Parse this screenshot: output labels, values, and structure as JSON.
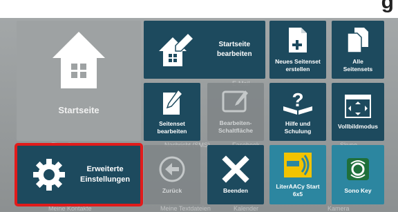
{
  "header": {
    "partial_title": "g"
  },
  "background_labels": {
    "settings": "Einstellungen",
    "message_sms": "Nachricht (SMS)",
    "facebook": "Facebook",
    "skype": "Skype",
    "my_contacts": "Meine Kontakte",
    "my_text_files": "Meine Textdateien",
    "calendar": "Kalender",
    "camera": "Kamera",
    "email": "E-Mail"
  },
  "tiles": {
    "home": {
      "label": "Startseite"
    },
    "start_edit": {
      "line1": "Startseite",
      "line2": "bearbeiten"
    },
    "new_set": {
      "line1": "Neues Seitenset",
      "line2": "erstellen"
    },
    "all_sets": {
      "line1": "Alle",
      "line2": "Seitensets"
    },
    "set_edit": {
      "line1": "Seitenset",
      "line2": "bearbeiten"
    },
    "button_edit": {
      "line1": "Bearbeiten-",
      "line2": "Schaltfläche"
    },
    "help": {
      "line1": "Hilfe und",
      "line2": "Schulung"
    },
    "fullscreen": {
      "label": "Vollbildmodus"
    },
    "advanced": {
      "line1": "Erweiterte",
      "line2": "Einstellungen"
    },
    "back": {
      "label": "Zurück"
    },
    "exit": {
      "label": "Beenden"
    },
    "literaacy": {
      "line1": "LiterAACy Start",
      "line2": "6x5"
    },
    "sonokey": {
      "label": "Sono Key"
    }
  },
  "colors": {
    "tile_dark": "#1d4a5e",
    "tile_teal": "#2c86a0",
    "highlight": "#e11b1b"
  }
}
